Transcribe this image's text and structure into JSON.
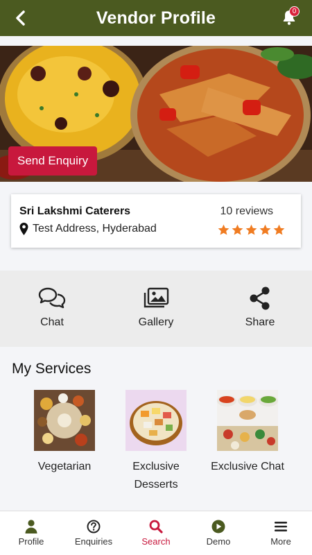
{
  "header": {
    "title": "Vendor Profile",
    "notification_count": "0",
    "color": "#4b5a20"
  },
  "hero": {
    "enquiry_button": "Send Enquiry",
    "button_color": "#c8183d"
  },
  "vendor": {
    "name": "Sri Lakshmi Caterers",
    "address": "Test Address, Hyderabad",
    "reviews": "10 reviews",
    "rating": 5,
    "star_color": "#f07c22"
  },
  "actions": [
    {
      "label": "Chat",
      "icon": "chat-icon"
    },
    {
      "label": "Gallery",
      "icon": "gallery-icon"
    },
    {
      "label": "Share",
      "icon": "share-icon"
    }
  ],
  "services": {
    "title": "My Services",
    "items": [
      {
        "label": "Vegetarian"
      },
      {
        "label": "Exclusive Desserts"
      },
      {
        "label": "Exclusive Chat"
      }
    ]
  },
  "bottom_nav": [
    {
      "label": "Profile",
      "icon": "user-icon",
      "active": false
    },
    {
      "label": "Enquiries",
      "icon": "question-icon",
      "active": false
    },
    {
      "label": "Search",
      "icon": "search-icon",
      "active": true
    },
    {
      "label": "Demo",
      "icon": "play-icon",
      "active": false
    },
    {
      "label": "More",
      "icon": "menu-icon",
      "active": false
    }
  ]
}
